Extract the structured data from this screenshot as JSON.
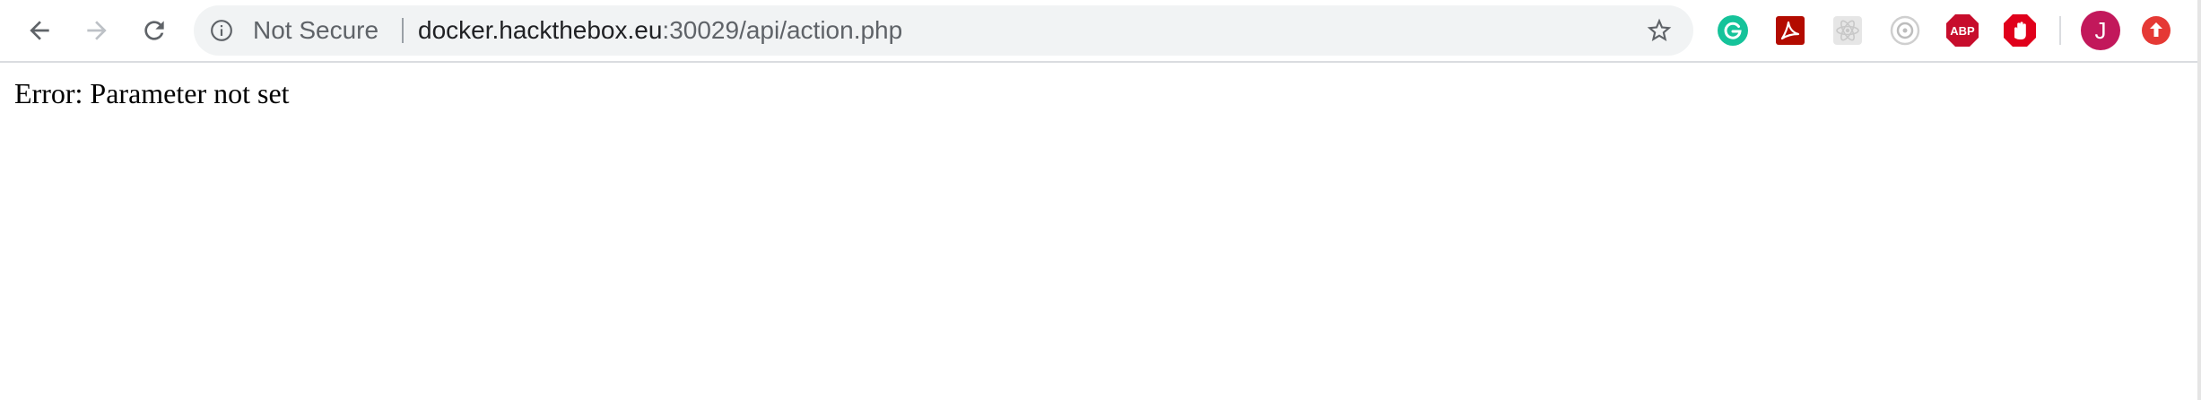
{
  "toolbar": {
    "back_icon": "arrow-left-icon",
    "forward_icon": "arrow-right-icon",
    "reload_icon": "reload-icon"
  },
  "omnibox": {
    "security_icon": "info-circle-icon",
    "security_label": "Not Secure",
    "url_host": "docker.hackthebox.eu",
    "url_path": ":30029/api/action.php",
    "bookmark_icon": "star-outline-icon"
  },
  "extensions": [
    {
      "name": "grammarly-icon",
      "color": "#15c39a"
    },
    {
      "name": "acrobat-icon",
      "color": "#b30b00"
    },
    {
      "name": "react-devtools-icon",
      "color": "#c8c8c8"
    },
    {
      "name": "extension-circle-icon",
      "color": "#bdbdbd"
    },
    {
      "name": "adblock-plus-icon",
      "color": "#c70d2c",
      "label": "ABP"
    },
    {
      "name": "adblock-hand-icon",
      "color": "#e0001b"
    }
  ],
  "profile": {
    "initial": "J",
    "color": "#c2185b"
  },
  "update_button": {
    "icon": "arrow-up-circle-icon",
    "color": "#e53935"
  },
  "page": {
    "body_text": "Error: Parameter not set"
  }
}
